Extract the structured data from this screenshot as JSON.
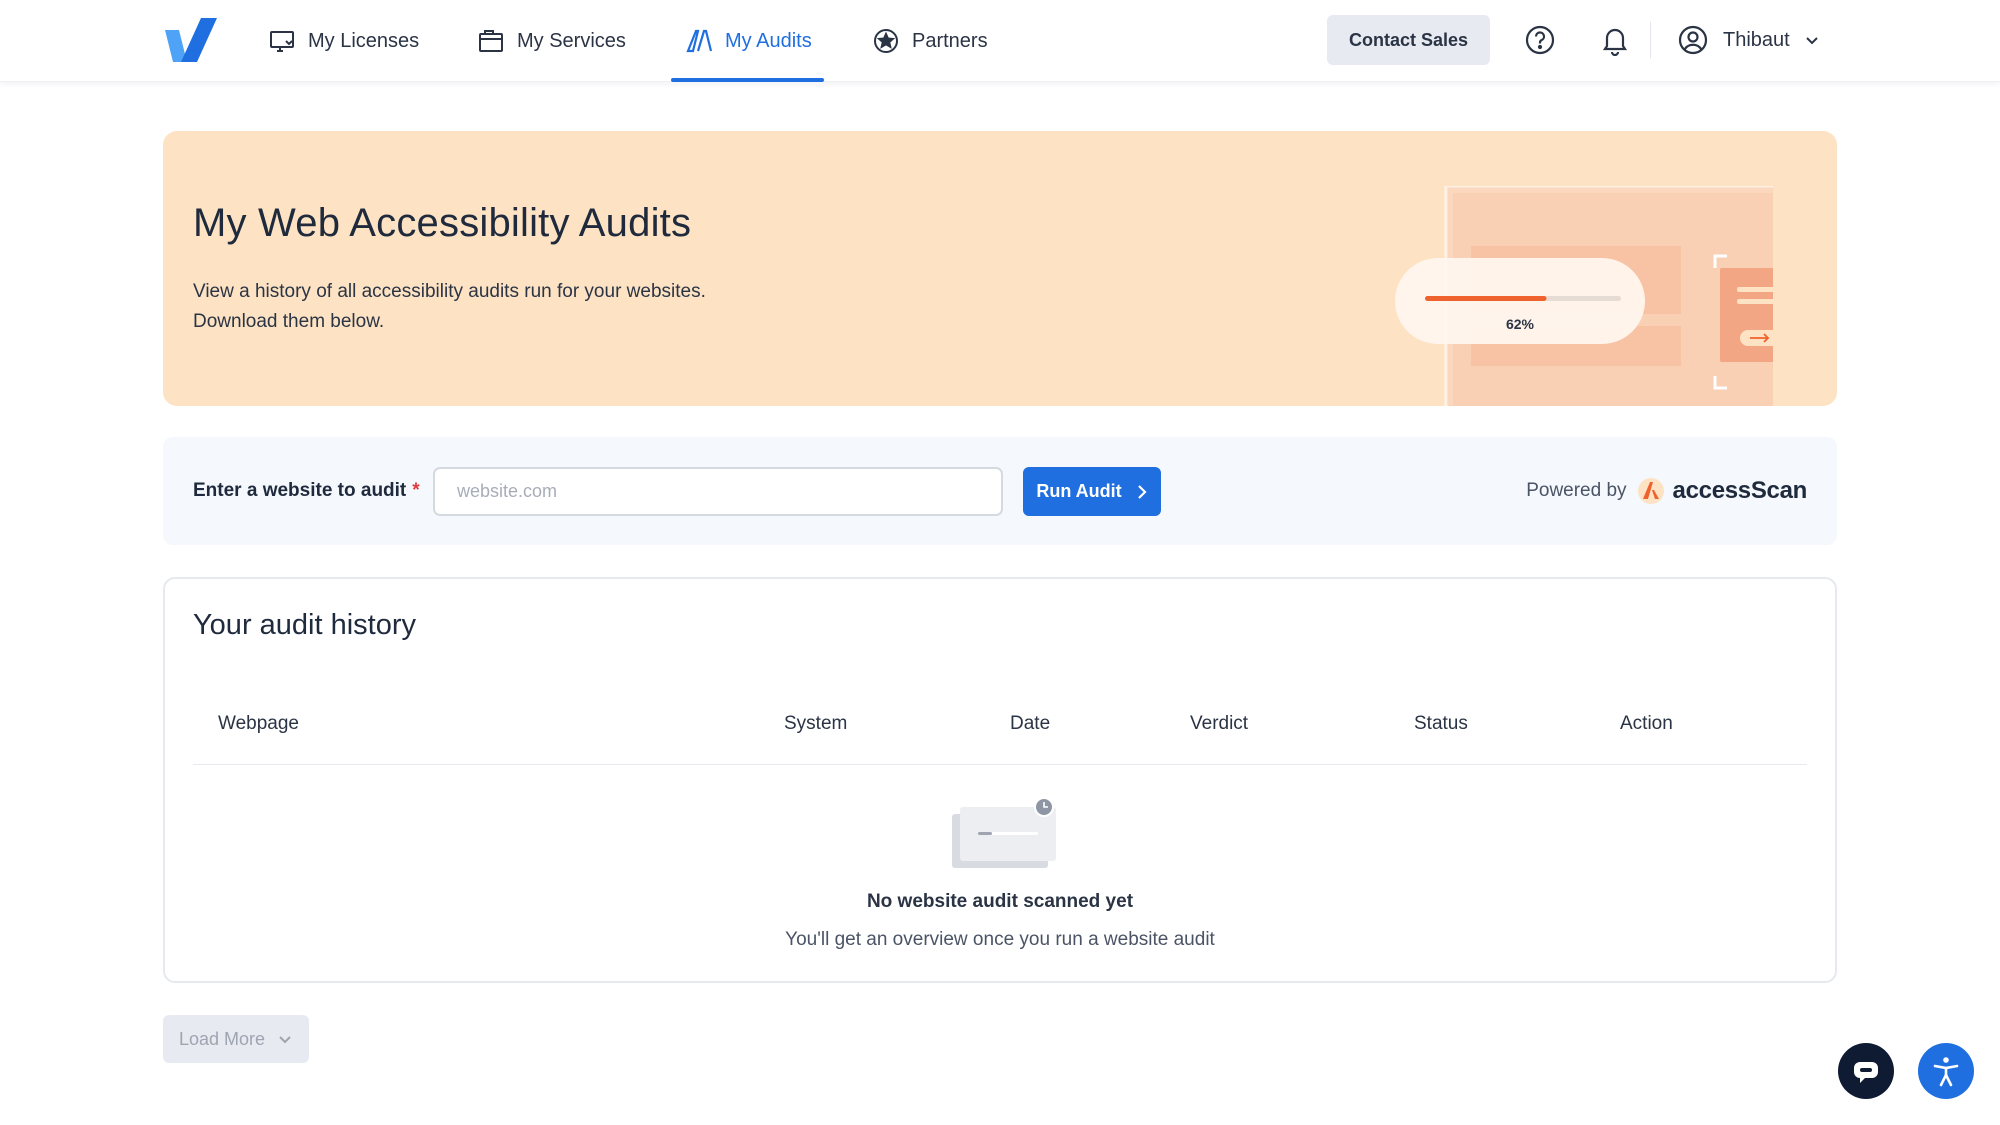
{
  "nav": {
    "items": [
      {
        "label": "My Licenses",
        "icon": "licenses-icon"
      },
      {
        "label": "My Services",
        "icon": "services-icon"
      },
      {
        "label": "My Audits",
        "icon": "audits-icon",
        "active": true
      },
      {
        "label": "Partners",
        "icon": "partners-icon"
      }
    ],
    "contact_sales": "Contact Sales",
    "user_name": "Thibaut"
  },
  "hero": {
    "title": "My Web Accessibility Audits",
    "description_line1": "View a history of all accessibility audits run for your websites.",
    "description_line2": "Download them below.",
    "progress_label": "62%",
    "progress_value": 0.62
  },
  "audit": {
    "label": "Enter a website to audit",
    "required_mark": "*",
    "placeholder": "website.com",
    "value": "",
    "run_button": "Run Audit",
    "powered_by": "Powered by",
    "brand": "accessScan"
  },
  "history": {
    "title": "Your audit history",
    "columns": [
      "Webpage",
      "System",
      "Date",
      "Verdict",
      "Status",
      "Action"
    ],
    "rows": [],
    "empty_title": "No website audit scanned yet",
    "empty_subtitle": "You'll get an overview once you run a website audit"
  },
  "load_more": "Load More",
  "colors": {
    "accent": "#1f6fe0",
    "hero_bg": "#fde3c3",
    "brand_orange": "#f0622d"
  }
}
